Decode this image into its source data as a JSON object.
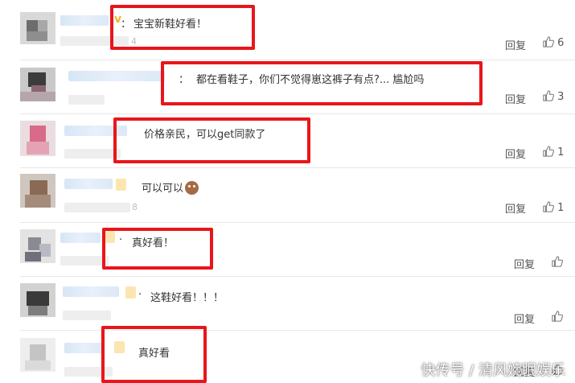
{
  "comments": [
    {
      "text": "宝宝新鞋好看！",
      "colon": "：",
      "reply": "回复",
      "likes": "6",
      "ghost": "4"
    },
    {
      "text": "都在看鞋子，你们不觉得崽这裤子有点?... 尴尬吗",
      "colon": "：",
      "reply": "回复",
      "likes": "3",
      "ghost": ""
    },
    {
      "text": "价格亲民，可以get同款了",
      "colon": "",
      "reply": "回复",
      "likes": "1",
      "ghost": ""
    },
    {
      "text": "可以可以",
      "colon": "",
      "reply": "回复",
      "likes": "1",
      "ghost": "8"
    },
    {
      "text": "真好看！",
      "colon": "·",
      "reply": "回复",
      "likes": "",
      "ghost": ""
    },
    {
      "text": "这鞋好看！！！",
      "colon": "·",
      "reply": "回复",
      "likes": "",
      "ghost": ""
    },
    {
      "text": "真好看",
      "colon": "",
      "reply": "回复",
      "likes": "",
      "ghost": ""
    }
  ],
  "icons": {
    "like": "thumbs-up-icon",
    "emoji": "jerry-mouse-emoji-icon"
  },
  "colors": {
    "highlight_box": "#e8161b",
    "text": "#333333",
    "separator": "#e8e8e8"
  },
  "watermark": "快传号 / 清风婉眠娱乐"
}
